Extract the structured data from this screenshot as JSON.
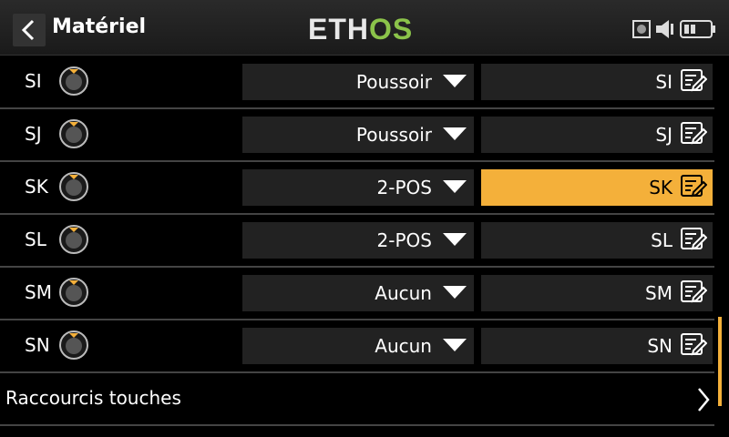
{
  "header": {
    "title": "Matériel",
    "logo_part1": "ETH",
    "logo_part2": "OS"
  },
  "rows": [
    {
      "label": "SI",
      "type": "Poussoir",
      "name": "SI",
      "active": false
    },
    {
      "label": "SJ",
      "type": "Poussoir",
      "name": "SJ",
      "active": false
    },
    {
      "label": "SK",
      "type": "2-POS",
      "name": "SK",
      "active": true
    },
    {
      "label": "SL",
      "type": "2-POS",
      "name": "SL",
      "active": false
    },
    {
      "label": "SM",
      "type": "Aucun",
      "name": "SM",
      "active": false
    },
    {
      "label": "SN",
      "type": "Aucun",
      "name": "SN",
      "active": false
    }
  ],
  "shortcut": {
    "label": "Raccourcis touches"
  },
  "colors": {
    "accent": "#f4b03a",
    "logo_green": "#8bc34a",
    "field_bg": "#222222"
  }
}
